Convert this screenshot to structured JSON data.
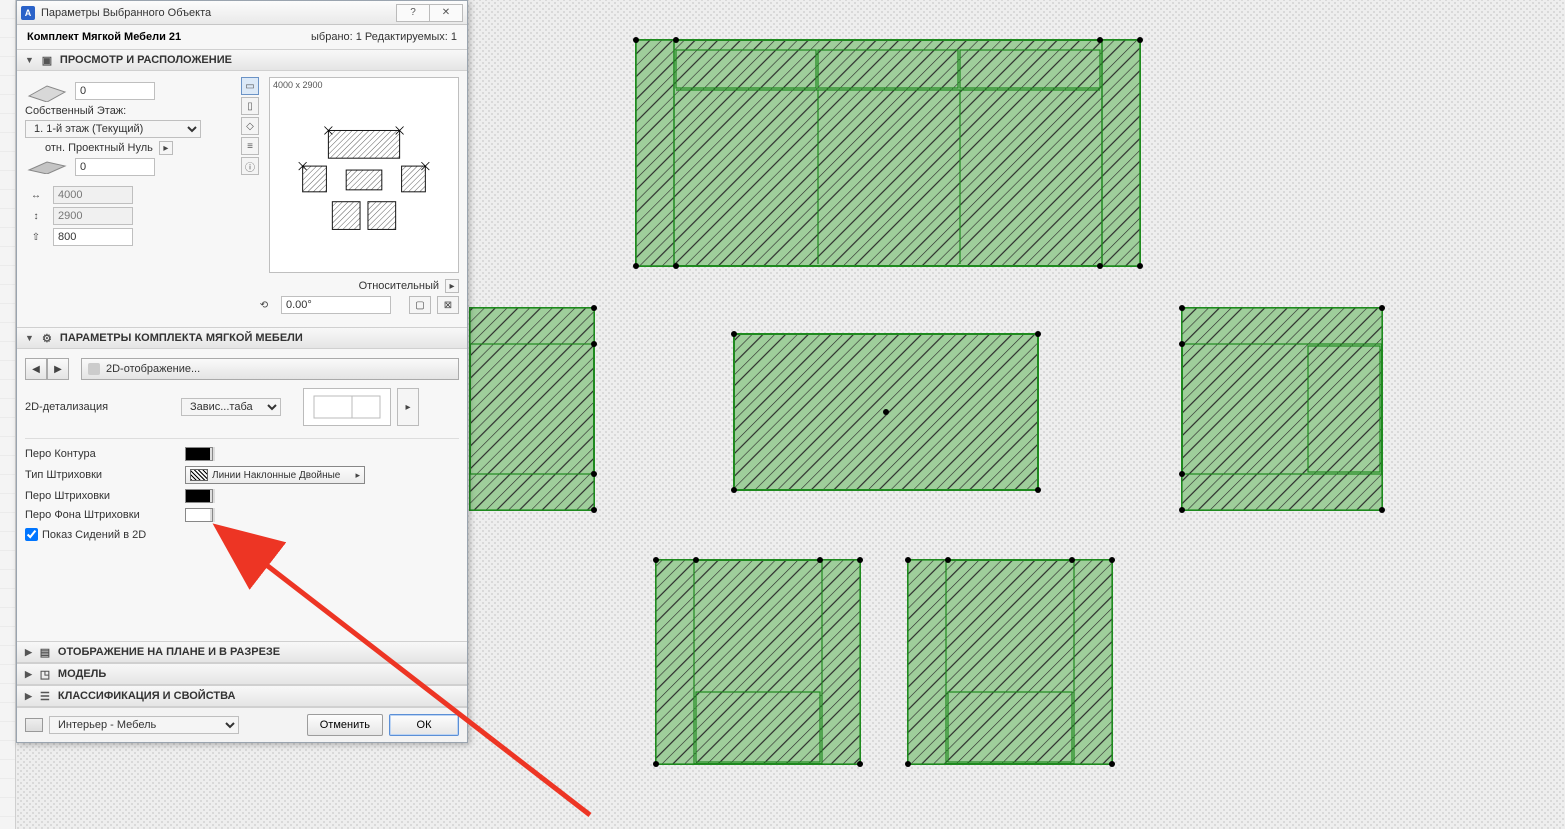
{
  "window": {
    "title": "Параметры Выбранного Объекта",
    "selected_count": "ыбрано: 1 Редактируемых: 1",
    "object_name": "Комплект Мягкой Мебели 21"
  },
  "sections": {
    "preview": {
      "title": "ПРОСМОТР И РАСПОЛОЖЕНИЕ"
    },
    "params": {
      "title": "ПАРАМЕТРЫ КОМПЛЕКТА МЯГКОЙ МЕБЕЛИ"
    },
    "floorplan": {
      "title": "ОТОБРАЖЕНИЕ НА ПЛАНЕ И В РАЗРЕЗЕ"
    },
    "model": {
      "title": "МОДЕЛЬ"
    },
    "class": {
      "title": "КЛАССИФИКАЦИЯ И СВОЙСТВА"
    }
  },
  "placement": {
    "z_top": "0",
    "own_story_lbl": "Собственный Этаж:",
    "story": "1. 1-й этаж (Текущий)",
    "ref_lbl": "отн. Проектный Нуль",
    "z_bottom": "0",
    "dim_x": "4000",
    "dim_y": "2900",
    "dim_z": "800",
    "relative_lbl": "Относительный",
    "angle": "0.00°",
    "preview_size": "4000 x 2900"
  },
  "params_page": {
    "page_name": "2D-отображение...",
    "detail_lbl": "2D-детализация",
    "detail_value": "Завис...таба"
  },
  "hatch": {
    "contour_pen": "Перо Контура",
    "hatch_type": "Тип Штриховки",
    "hatch_type_val": "Линии Наклонные Двойные",
    "hatch_pen": "Перо Штриховки",
    "bg_pen": "Перо Фона Штриховки",
    "show_seats": "Показ Сидений в 2D"
  },
  "footer": {
    "layer": "Интерьер - Мебель",
    "cancel": "Отменить",
    "ok": "ОК"
  }
}
